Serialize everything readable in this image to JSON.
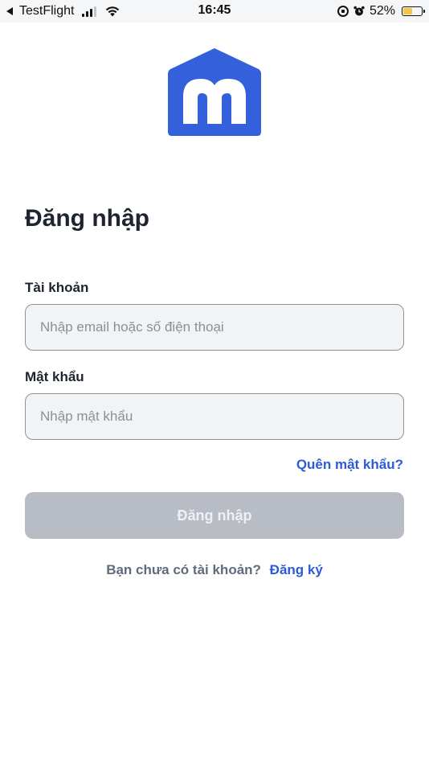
{
  "status_bar": {
    "back_app": "TestFlight",
    "time": "16:45",
    "battery_percent": "52%",
    "battery_level": 0.52,
    "battery_color": "#f3c64a"
  },
  "logo": {
    "icon": "house-m-logo-icon",
    "color": "#3460dc"
  },
  "login": {
    "title": "Đăng nhập",
    "account_label": "Tài khoản",
    "account_placeholder": "Nhập email hoặc số điện thoại",
    "account_value": "",
    "password_label": "Mật khẩu",
    "password_placeholder": "Nhập mật khẩu",
    "password_value": "",
    "forgot_link": "Quên mật khẩu?",
    "submit_label": "Đăng nhập",
    "signup_prompt": "Bạn chưa có tài khoản?",
    "signup_link": "Đăng ký"
  },
  "colors": {
    "accent": "#2d5ad8",
    "disabled_button": "#b8bcc5",
    "input_background": "#f2f3f5"
  }
}
